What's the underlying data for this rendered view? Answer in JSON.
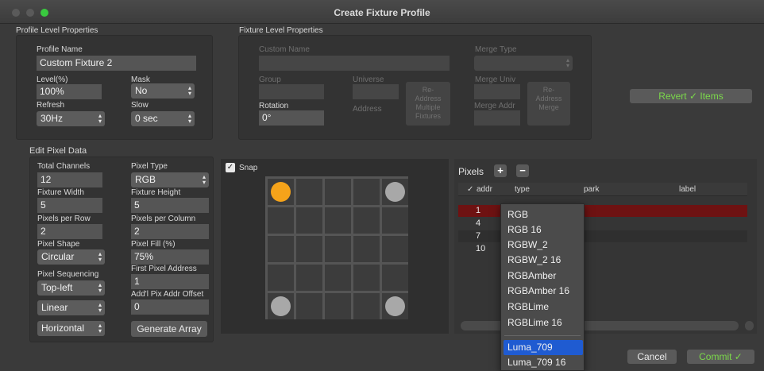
{
  "window": {
    "title": "Create Fixture Profile"
  },
  "profile_level": {
    "heading": "Profile Level Properties",
    "profile_name_label": "Profile Name",
    "profile_name_value": "Custom Fixture 2",
    "level_label": "Level(%)",
    "level_value": "100%",
    "mask_label": "Mask",
    "mask_value": "No",
    "refresh_label": "Refresh",
    "refresh_value": "30Hz",
    "slow_label": "Slow",
    "slow_value": "0 sec"
  },
  "fixture_level": {
    "heading": "Fixture Level Properties",
    "custom_name_label": "Custom Name",
    "merge_type_label": "Merge Type",
    "group_label": "Group",
    "universe_label": "Universe",
    "readdress_multiple_label": "Re-\nAddress\nMultiple\nFixtures",
    "merge_univ_label": "Merge Univ",
    "readdress_merge_label": "Re-\nAddress\nMerge",
    "rotation_label": "Rotation",
    "rotation_value": "0°",
    "address_label": "Address",
    "merge_addr_label": "Merge Addr"
  },
  "revert_label": "Revert ✓ Items",
  "edit_pixel": {
    "heading": "Edit Pixel Data",
    "total_channels_label": "Total Channels",
    "total_channels_value": "12",
    "pixel_type_label": "Pixel Type",
    "pixel_type_value": "RGB",
    "fixture_width_label": "Fixture Width",
    "fixture_width_value": "5",
    "fixture_height_label": "Fixture Height",
    "fixture_height_value": "5",
    "pixels_per_row_label": "Pixels per Row",
    "pixels_per_row_value": "2",
    "pixels_per_column_label": "Pixels per Column",
    "pixels_per_column_value": "2",
    "pixel_shape_label": "Pixel Shape",
    "pixel_shape_value": "Circular",
    "pixel_fill_label": "Pixel Fill (%)",
    "pixel_fill_value": "75%",
    "pixel_sequencing_label": "Pixel Sequencing",
    "pixel_sequencing_value": "Top-left",
    "first_pixel_address_label": "First Pixel Address",
    "first_pixel_address_value": "1",
    "linear_value": "Linear",
    "addl_offset_label": "Add'l Pix Addr Offset",
    "addl_offset_value": "0",
    "horizontal_value": "Horizontal",
    "generate_label": "Generate Array"
  },
  "snap_label": "Snap",
  "pixels": {
    "heading": "Pixels",
    "columns": [
      "✓",
      "addr",
      "type",
      "park",
      "label"
    ],
    "rows": [
      "1",
      "4",
      "7",
      "10"
    ]
  },
  "dropdown": {
    "items": [
      "RGB",
      "RGB 16",
      "RGBW_2",
      "RGBW_2 16",
      "RGBAmber",
      "RGBAmber 16",
      "RGBLime",
      "RGBLime 16",
      "Luma_709",
      "Luma_709 16"
    ],
    "selected": "Luma_709"
  },
  "footer": {
    "cancel_label": "Cancel",
    "commit_label": "Commit ✓"
  },
  "colors": {
    "accent_green": "#7bd94a",
    "selected_row": "#6e1212",
    "menu_highlight": "#1f5bd1",
    "pixel_orange": "#f5a31a"
  }
}
